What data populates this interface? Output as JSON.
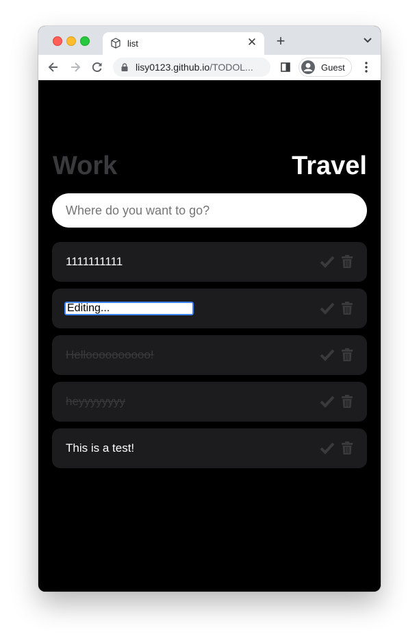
{
  "browser": {
    "tab_title": "list",
    "url_host": "lisy0123.github.io",
    "url_path": "/TODOL...",
    "profile_label": "Guest"
  },
  "app": {
    "tabs": [
      {
        "label": "Work",
        "active": false
      },
      {
        "label": "Travel",
        "active": true
      }
    ],
    "input_placeholder": "Where do you want to go?",
    "todos": [
      {
        "text": "1111111111",
        "done": false,
        "editing": false
      },
      {
        "text": "Editing...",
        "done": false,
        "editing": true
      },
      {
        "text": "Helloooooooooo!",
        "done": true,
        "editing": false
      },
      {
        "text": "heyyyyyyyy",
        "done": true,
        "editing": false
      },
      {
        "text": "This is a test!",
        "done": false,
        "editing": false
      }
    ]
  },
  "colors": {
    "background": "#000000",
    "card": "#1c1c1e",
    "inactive_text": "#3a3a3c",
    "active_text": "#ffffff",
    "icon_gray": "#3a3a3c"
  },
  "icons": [
    "favicon-icon",
    "close-icon",
    "plus-icon",
    "chevron-down-icon",
    "back-icon",
    "forward-icon",
    "reload-icon",
    "lock-icon",
    "side-panel-icon",
    "avatar-icon",
    "menu-icon",
    "check-icon",
    "trash-icon"
  ]
}
